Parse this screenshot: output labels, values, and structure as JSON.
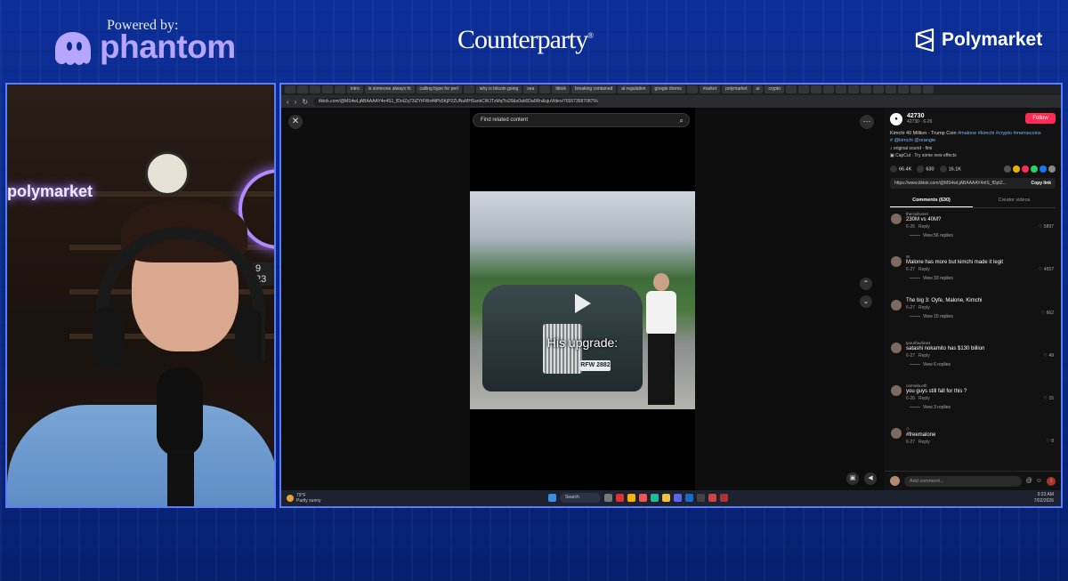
{
  "branding": {
    "powered_by": "Powered by:",
    "phantom": "phantom",
    "counterparty": "Counterparty",
    "counterparty_mark": "®",
    "polymarket": "Polymarket"
  },
  "webcam": {
    "neon_sign": "polymarket",
    "clock_readout": "9 23"
  },
  "browser": {
    "tabs": [
      "",
      "",
      "",
      "",
      "",
      "intro",
      "is someone always th",
      "calling bypo for perl",
      "",
      "why is bitcoin going",
      "sea",
      "",
      "tiktok",
      "breaking contained",
      "ai regulation",
      "google dorms",
      "",
      "market",
      "polymarket",
      "ai",
      "crypto",
      "",
      "",
      "",
      "",
      "",
      "",
      "",
      "",
      "",
      "",
      "",
      ""
    ],
    "url": "tiktok.com/@MS4wLjABAAAAY4n4S1_fDoIZq73iZYtFWsf4iPk5KjP2ZUNuMHSsnkCWJTzMq?is20&x0ab0Da0Rn&ujuVideo/7655735870875602 19..."
  },
  "tiktok": {
    "search_placeholder": "Find related content",
    "caption": "His upgrade:",
    "plate": "RFW 2882",
    "author": {
      "name": "42730",
      "sub": "42730 · 6-26",
      "follow": "Follow"
    },
    "description_prefix": "Kimchi 40 Million - Trump Coin ",
    "description_tags": "#malone #kimchi #crypto #memecoins",
    "description_line2": "# @kimchi @orangie",
    "sound": "original sound - fimi",
    "capcut": "CapCut · Try some new effects",
    "stats": {
      "likes": "66.4K",
      "comments": "630",
      "saves": "16.1K"
    },
    "share_link": "https://www.tiktok.com/@MS4wLjABAAAAY4nlS_fDpIZ...",
    "copy_link": "Copy link",
    "tab_comments": "Comments (630)",
    "tab_creator": "Creator videos",
    "comments": [
      {
        "user": "thecndromer",
        "text": "230M vs 40M?",
        "date": "6-26",
        "reply": "Reply",
        "likes": "5897",
        "replies": "View 56 replies"
      },
      {
        "user": "W",
        "text": "Malone has more but kimchi made it legit",
        "date": "6-27",
        "reply": "Reply",
        "likes": "4557",
        "replies": "View 33 replies"
      },
      {
        "user": "",
        "text": "The big 3: Oyfe, Malone, Kimchi",
        "date": "6-27",
        "reply": "Reply",
        "likes": "662",
        "replies": "View 15 replies"
      },
      {
        "user": "Ipourfourlines",
        "text": "satashi nokamito has $130 billion",
        "date": "6-27",
        "reply": "Reply",
        "likes": "49",
        "replies": "View 6 replies"
      },
      {
        "user": "carmela.eth",
        "text": "you guys still fall for this ?",
        "date": "6-26",
        "reply": "Reply",
        "likes": "15",
        "replies": "View 3 replies"
      },
      {
        "user": "◇",
        "text": "#freemalone",
        "date": "6-27",
        "reply": "Reply",
        "likes": "8",
        "replies": ""
      }
    ],
    "add_comment_placeholder": "Add comment..."
  },
  "taskbar": {
    "weather_temp": "79°F",
    "weather_desc": "Partly sunny",
    "search": "Search",
    "time": "9:23 AM",
    "date": "7/02/2026"
  },
  "colors": {
    "background": "#0a2a8a",
    "frame": "#5a7cff",
    "tiktok_red": "#fe2c55",
    "phantom_purple": "#b7a6ff"
  }
}
